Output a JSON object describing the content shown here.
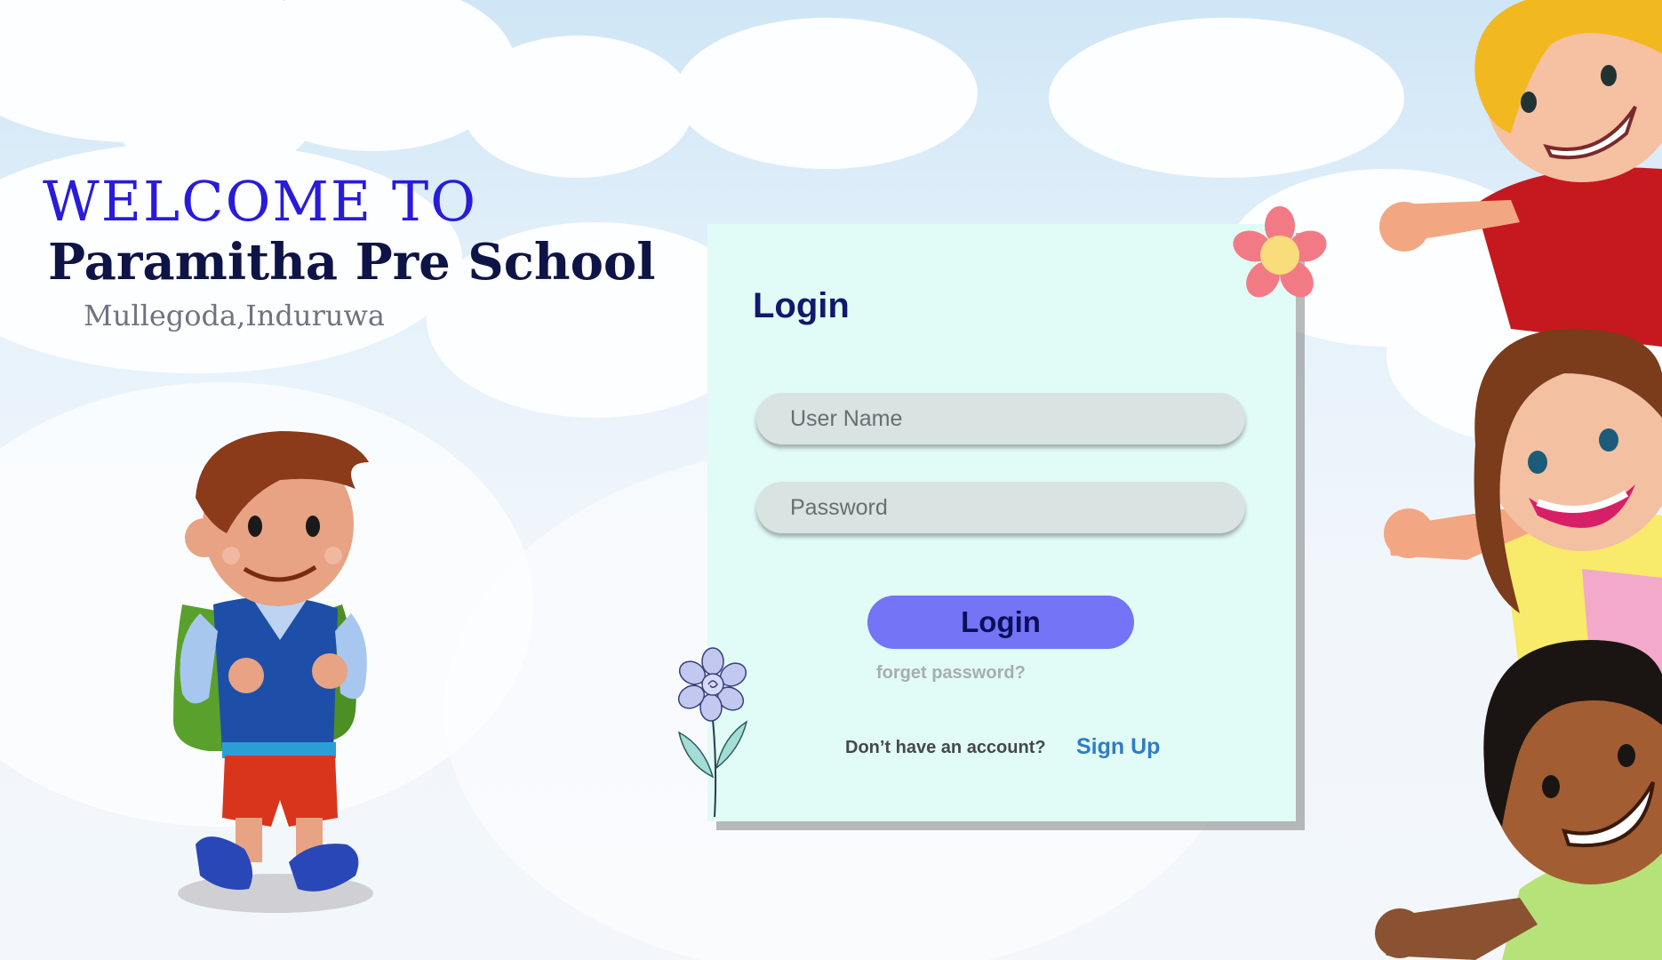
{
  "hero": {
    "welcome": "WELCOME TO",
    "school_name": "Paramitha Pre School",
    "location": "Mullegoda,Induruwa"
  },
  "login_card": {
    "title": "Login",
    "username_placeholder": "User Name",
    "password_placeholder": "Password",
    "login_button": "Login",
    "forgot_link": "forget password?",
    "no_account_text": "Don’t have an account?",
    "signup_link": "Sign Up"
  },
  "icons": [
    "pink-flower-icon",
    "blue-flower-icon",
    "schoolboy-illustration",
    "waving-kids-illustration"
  ],
  "colors": {
    "card_background": "#e1fbf7",
    "button": "#7474f6",
    "title_blue": "#2a1bd9",
    "school_navy": "#0f1446",
    "signup_link": "#2f7cc6"
  }
}
